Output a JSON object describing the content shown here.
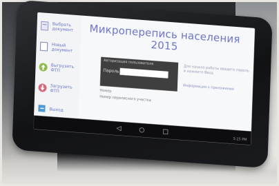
{
  "app": {
    "title": "Микроперепись населения 2015"
  },
  "sidebar": {
    "items": [
      {
        "label": "Выбрать документ",
        "icon": "document-icon"
      },
      {
        "label": "Новый документ",
        "icon": "new-document-icon"
      },
      {
        "label": "Выгрузить ФТП",
        "icon": "upload-icon"
      },
      {
        "label": "Загрузить ФТП",
        "icon": "download-icon"
      },
      {
        "label": "Выход",
        "icon": "exit-icon"
      }
    ]
  },
  "login": {
    "header": "Авторизация пользователя",
    "password_label": "Пароль",
    "password_value": ""
  },
  "info": {
    "line1": "Номер",
    "line2": "Номер переписного участка"
  },
  "right": {
    "text": "Для начала работы введите пароль и нажмите Ввод",
    "link": "Информация о приложении"
  },
  "status": {
    "clock": "3:15 PM"
  },
  "colors": {
    "accent": "#6b73c8",
    "panel": "#3f3f3f",
    "navbar": "#0d0d0f"
  }
}
